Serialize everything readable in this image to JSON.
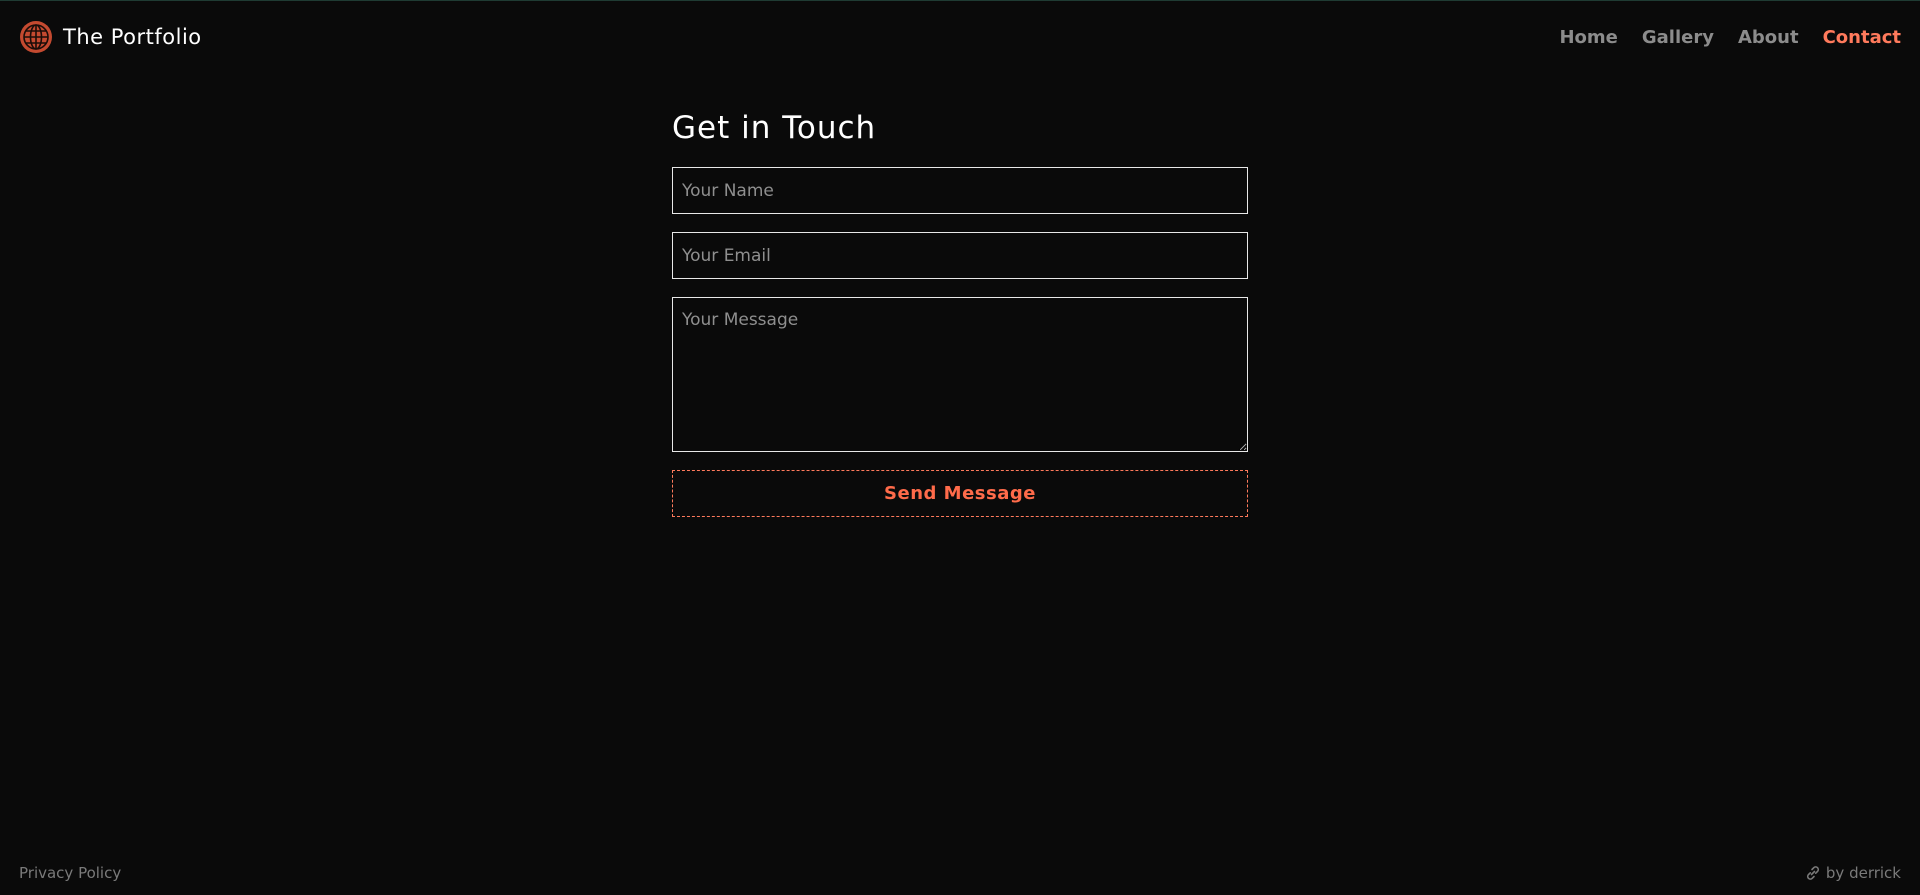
{
  "header": {
    "brand_name": "The Portfolio",
    "brand_icon": "globe-icon",
    "nav": [
      {
        "label": "Home",
        "active": false
      },
      {
        "label": "Gallery",
        "active": false
      },
      {
        "label": "About",
        "active": false
      },
      {
        "label": "Contact",
        "active": true
      }
    ]
  },
  "contact": {
    "title": "Get in Touch",
    "name_placeholder": "Your Name",
    "email_placeholder": "Your Email",
    "message_placeholder": "Your Message",
    "submit_label": "Send Message"
  },
  "footer": {
    "privacy_label": "Privacy Policy",
    "credit_icon": "link-icon",
    "credit_label": "by derrick"
  },
  "colors": {
    "background": "#0a0a0a",
    "accent": "#ff7a5c",
    "nav_inactive": "#8c8c8c",
    "border": "#e8e8e8"
  }
}
